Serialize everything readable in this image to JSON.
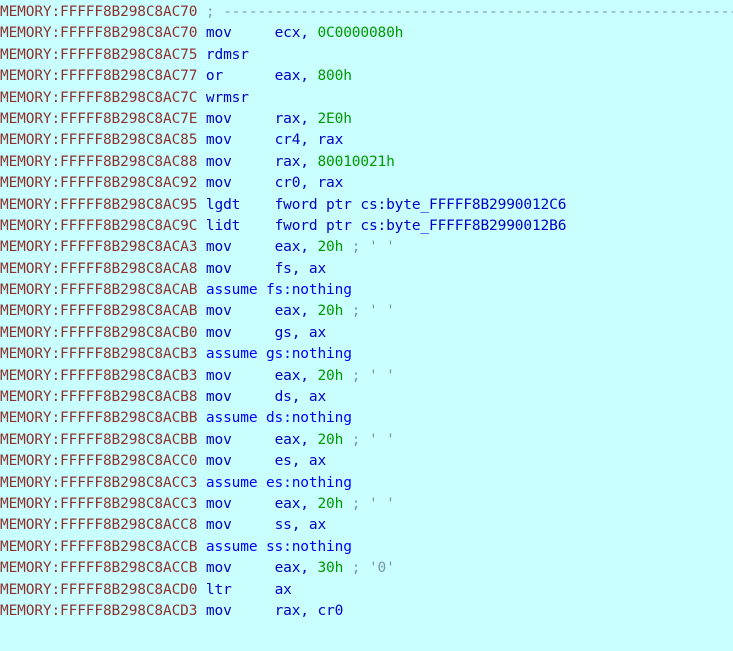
{
  "view": {
    "name": "IDA Pro disassembly listing",
    "segment": "MEMORY",
    "background_color": "#c9ffff",
    "colors": {
      "address": "#8c3330",
      "mnemonic": "#0000c8",
      "operand": "#0000c8",
      "number": "#009900",
      "comment": "#7a96ac",
      "directive": "#0000ff"
    }
  },
  "lines": [
    {
      "address": "MEMORY:FFFFF8B298C8AC70",
      "kind": "comment",
      "mnemonic": "",
      "operands": "",
      "comment": "; ---------------------------------------------------------------------------"
    },
    {
      "address": "MEMORY:FFFFF8B298C8AC70",
      "kind": "instruction",
      "mnemonic": "mov",
      "operands": "ecx, ",
      "number": "0C0000080h",
      "comment": ""
    },
    {
      "address": "MEMORY:FFFFF8B298C8AC75",
      "kind": "instruction",
      "mnemonic": "rdmsr",
      "operands": "",
      "number": "",
      "comment": ""
    },
    {
      "address": "MEMORY:FFFFF8B298C8AC77",
      "kind": "instruction",
      "mnemonic": "or",
      "operands": "eax, ",
      "number": "800h",
      "comment": ""
    },
    {
      "address": "MEMORY:FFFFF8B298C8AC7C",
      "kind": "instruction",
      "mnemonic": "wrmsr",
      "operands": "",
      "number": "",
      "comment": ""
    },
    {
      "address": "MEMORY:FFFFF8B298C8AC7E",
      "kind": "instruction",
      "mnemonic": "mov",
      "operands": "rax, ",
      "number": "2E0h",
      "comment": ""
    },
    {
      "address": "MEMORY:FFFFF8B298C8AC85",
      "kind": "instruction",
      "mnemonic": "mov",
      "operands": "cr4, rax",
      "number": "",
      "comment": ""
    },
    {
      "address": "MEMORY:FFFFF8B298C8AC88",
      "kind": "instruction",
      "mnemonic": "mov",
      "operands": "rax, ",
      "number": "80010021h",
      "comment": ""
    },
    {
      "address": "MEMORY:FFFFF8B298C8AC92",
      "kind": "instruction",
      "mnemonic": "mov",
      "operands": "cr0, rax",
      "number": "",
      "comment": ""
    },
    {
      "address": "MEMORY:FFFFF8B298C8AC95",
      "kind": "instruction",
      "mnemonic": "lgdt",
      "operands": "fword ptr cs:byte_FFFFF8B2990012C6",
      "number": "",
      "comment": ""
    },
    {
      "address": "MEMORY:FFFFF8B298C8AC9C",
      "kind": "instruction",
      "mnemonic": "lidt",
      "operands": "fword ptr cs:byte_FFFFF8B2990012B6",
      "number": "",
      "comment": ""
    },
    {
      "address": "MEMORY:FFFFF8B298C8ACA3",
      "kind": "instruction",
      "mnemonic": "mov",
      "operands": "eax, ",
      "number": "20h",
      "comment": "; ' '"
    },
    {
      "address": "MEMORY:FFFFF8B298C8ACA8",
      "kind": "instruction",
      "mnemonic": "mov",
      "operands": "fs, ax",
      "number": "",
      "comment": ""
    },
    {
      "address": "MEMORY:FFFFF8B298C8ACAB",
      "kind": "directive",
      "mnemonic": "assume",
      "operands": "fs:nothing",
      "number": "",
      "comment": ""
    },
    {
      "address": "MEMORY:FFFFF8B298C8ACAB",
      "kind": "instruction",
      "mnemonic": "mov",
      "operands": "eax, ",
      "number": "20h",
      "comment": "; ' '"
    },
    {
      "address": "MEMORY:FFFFF8B298C8ACB0",
      "kind": "instruction",
      "mnemonic": "mov",
      "operands": "gs, ax",
      "number": "",
      "comment": ""
    },
    {
      "address": "MEMORY:FFFFF8B298C8ACB3",
      "kind": "directive",
      "mnemonic": "assume",
      "operands": "gs:nothing",
      "number": "",
      "comment": ""
    },
    {
      "address": "MEMORY:FFFFF8B298C8ACB3",
      "kind": "instruction",
      "mnemonic": "mov",
      "operands": "eax, ",
      "number": "20h",
      "comment": "; ' '"
    },
    {
      "address": "MEMORY:FFFFF8B298C8ACB8",
      "kind": "instruction",
      "mnemonic": "mov",
      "operands": "ds, ax",
      "number": "",
      "comment": ""
    },
    {
      "address": "MEMORY:FFFFF8B298C8ACBB",
      "kind": "directive",
      "mnemonic": "assume",
      "operands": "ds:nothing",
      "number": "",
      "comment": ""
    },
    {
      "address": "MEMORY:FFFFF8B298C8ACBB",
      "kind": "instruction",
      "mnemonic": "mov",
      "operands": "eax, ",
      "number": "20h",
      "comment": "; ' '"
    },
    {
      "address": "MEMORY:FFFFF8B298C8ACC0",
      "kind": "instruction",
      "mnemonic": "mov",
      "operands": "es, ax",
      "number": "",
      "comment": ""
    },
    {
      "address": "MEMORY:FFFFF8B298C8ACC3",
      "kind": "directive",
      "mnemonic": "assume",
      "operands": "es:nothing",
      "number": "",
      "comment": ""
    },
    {
      "address": "MEMORY:FFFFF8B298C8ACC3",
      "kind": "instruction",
      "mnemonic": "mov",
      "operands": "eax, ",
      "number": "20h",
      "comment": "; ' '"
    },
    {
      "address": "MEMORY:FFFFF8B298C8ACC8",
      "kind": "instruction",
      "mnemonic": "mov",
      "operands": "ss, ax",
      "number": "",
      "comment": ""
    },
    {
      "address": "MEMORY:FFFFF8B298C8ACCB",
      "kind": "directive",
      "mnemonic": "assume",
      "operands": "ss:nothing",
      "number": "",
      "comment": ""
    },
    {
      "address": "MEMORY:FFFFF8B298C8ACCB",
      "kind": "instruction",
      "mnemonic": "mov",
      "operands": "eax, ",
      "number": "30h",
      "comment": "; '0'"
    },
    {
      "address": "MEMORY:FFFFF8B298C8ACD0",
      "kind": "instruction",
      "mnemonic": "ltr",
      "operands": "ax",
      "number": "",
      "comment": ""
    },
    {
      "address": "MEMORY:FFFFF8B298C8ACD3",
      "kind": "instruction",
      "mnemonic": "mov",
      "operands": "rax, cr0",
      "number": "",
      "comment": ""
    }
  ]
}
